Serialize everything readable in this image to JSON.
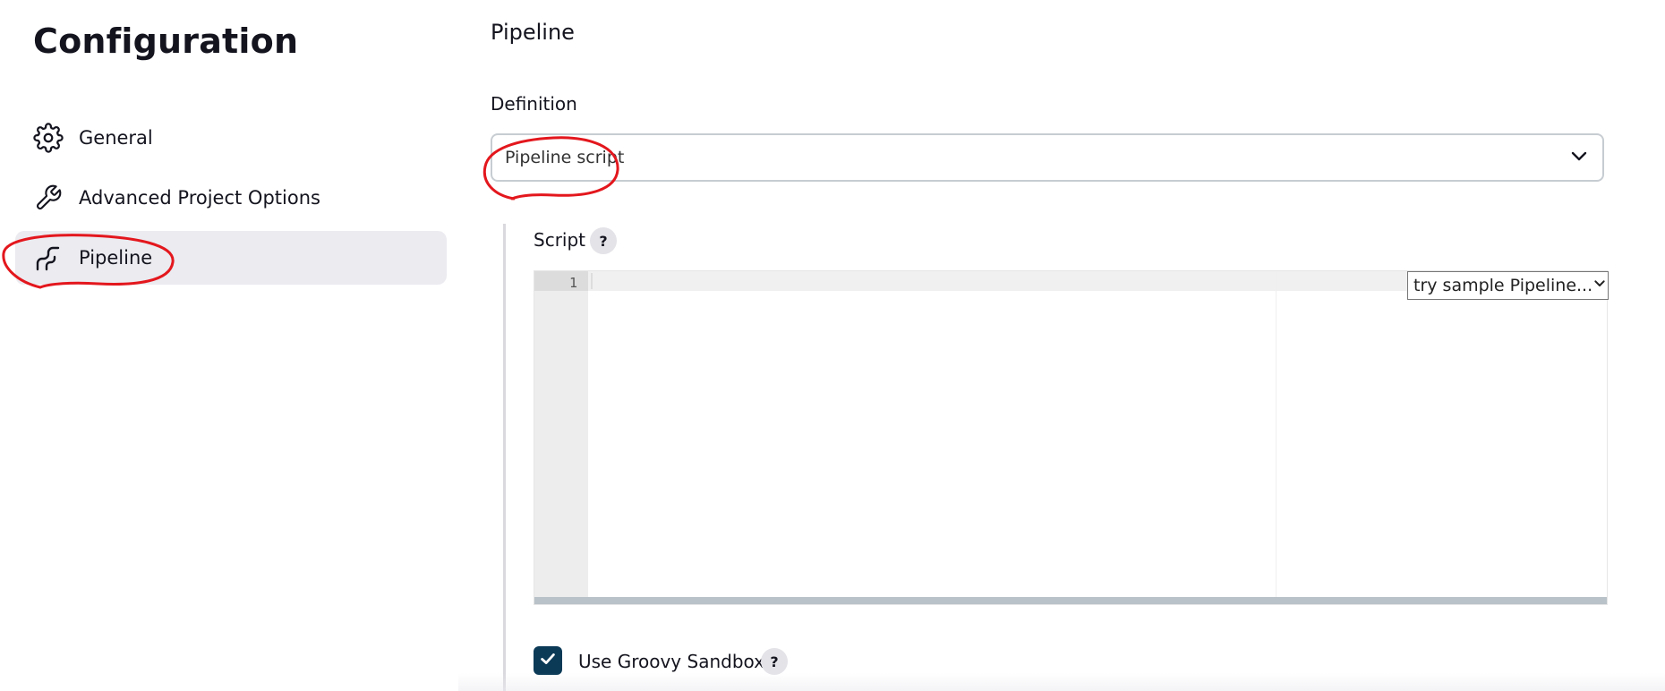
{
  "sidebar": {
    "title": "Configuration",
    "items": [
      {
        "label": "General",
        "icon": "gear-icon"
      },
      {
        "label": "Advanced Project Options",
        "icon": "wrench-icon"
      },
      {
        "label": "Pipeline",
        "icon": "pipeline-icon",
        "active": true
      }
    ]
  },
  "main": {
    "section_title": "Pipeline",
    "definition": {
      "label": "Definition",
      "selected": "Pipeline script",
      "icon": "chevron-down-icon"
    },
    "script": {
      "label": "Script",
      "help": "?",
      "line_number": "1",
      "sample_select": "try sample Pipeline..."
    },
    "sandbox": {
      "checked": true,
      "label": "Use Groovy Sandbox",
      "help": "?"
    }
  },
  "colors": {
    "active_bg": "#ebebf0",
    "checkbox_bg": "#0b3a57",
    "annotation_red": "#e3171d"
  }
}
